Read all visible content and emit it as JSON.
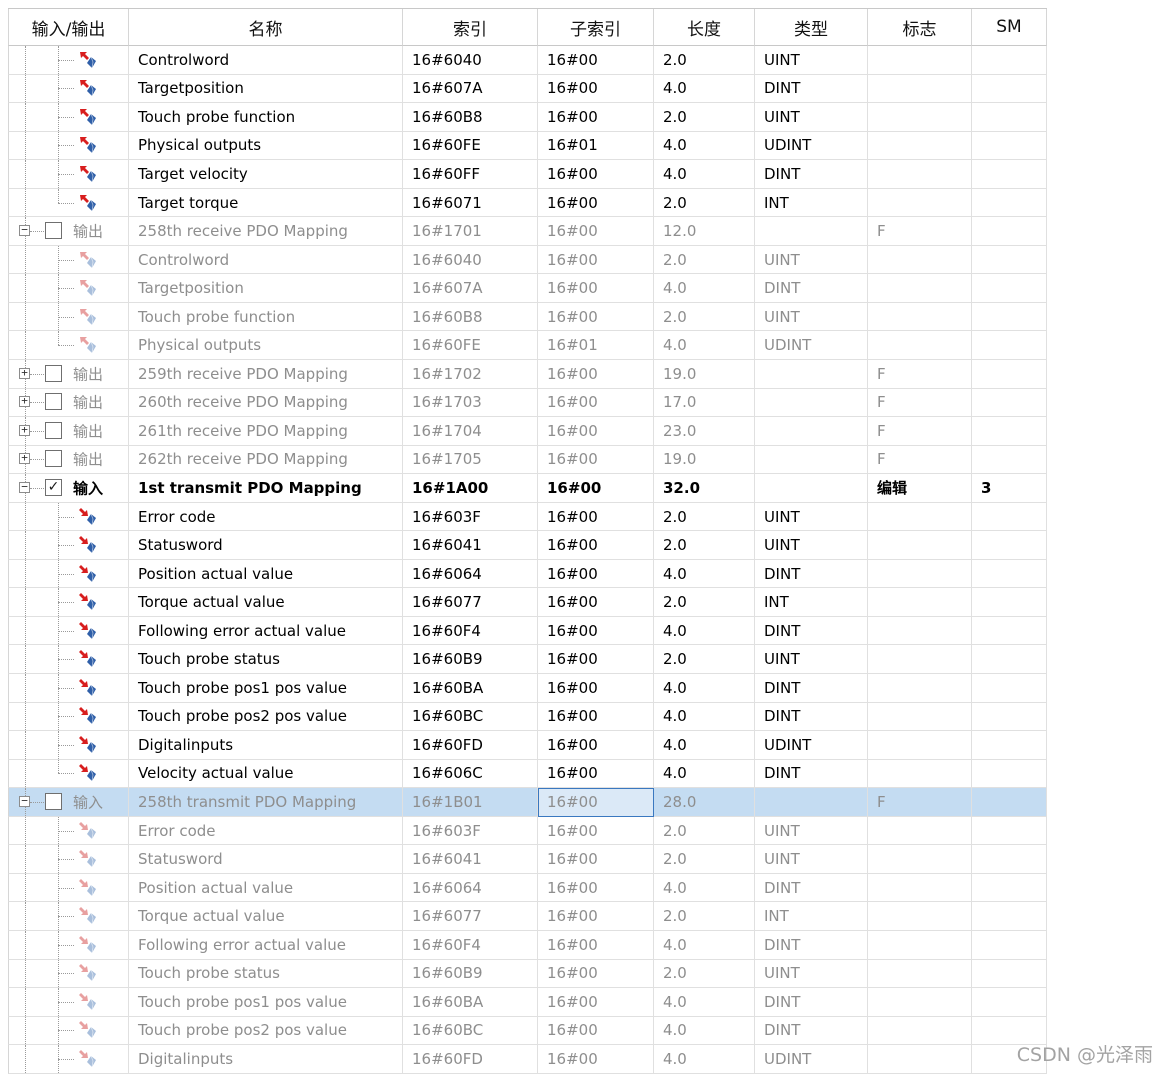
{
  "columns": [
    "输入/输出",
    "名称",
    "索引",
    "子索引",
    "长度",
    "类型",
    "标志",
    "SM"
  ],
  "icons": {
    "expand": "tree-expand-icon",
    "collapse": "tree-collapse-icon",
    "checkbox": "checkbox-icon",
    "param": "pdo-entry-icon"
  },
  "colors": {
    "selection": "#c4dcf2",
    "disabled_text": "#8e8e8e",
    "arrow_red": "#d81e1e",
    "gem_blue": "#2f5fa8"
  },
  "rows": [
    {
      "kind": "child",
      "state": "en",
      "name": "Controlword",
      "index": "16#6040",
      "sub": "16#00",
      "len": "2.0",
      "type": "UINT",
      "flag": "",
      "sm": "",
      "dir": "out"
    },
    {
      "kind": "child",
      "state": "en",
      "name": "Targetposition",
      "index": "16#607A",
      "sub": "16#00",
      "len": "4.0",
      "type": "DINT",
      "flag": "",
      "sm": "",
      "dir": "out"
    },
    {
      "kind": "child",
      "state": "en",
      "name": "Touch probe function",
      "index": "16#60B8",
      "sub": "16#00",
      "len": "2.0",
      "type": "UINT",
      "flag": "",
      "sm": "",
      "dir": "out"
    },
    {
      "kind": "child",
      "state": "en",
      "name": "Physical outputs",
      "index": "16#60FE",
      "sub": "16#01",
      "len": "4.0",
      "type": "UDINT",
      "flag": "",
      "sm": "",
      "dir": "out"
    },
    {
      "kind": "child",
      "state": "en",
      "name": "Target velocity",
      "index": "16#60FF",
      "sub": "16#00",
      "len": "4.0",
      "type": "DINT",
      "flag": "",
      "sm": "",
      "dir": "out"
    },
    {
      "kind": "child",
      "state": "en",
      "name": "Target torque",
      "index": "16#6071",
      "sub": "16#00",
      "len": "2.0",
      "type": "INT",
      "flag": "",
      "sm": "",
      "dir": "out",
      "last": true
    },
    {
      "kind": "group",
      "state": "dis",
      "expander": "−",
      "checked": false,
      "io": "输出",
      "name": "258th receive PDO Mapping",
      "index": "16#1701",
      "sub": "16#00",
      "len": "12.0",
      "type": "",
      "flag": "F",
      "sm": ""
    },
    {
      "kind": "child",
      "state": "dis",
      "name": "Controlword",
      "index": "16#6040",
      "sub": "16#00",
      "len": "2.0",
      "type": "UINT",
      "flag": "",
      "sm": "",
      "dir": "out"
    },
    {
      "kind": "child",
      "state": "dis",
      "name": "Targetposition",
      "index": "16#607A",
      "sub": "16#00",
      "len": "4.0",
      "type": "DINT",
      "flag": "",
      "sm": "",
      "dir": "out"
    },
    {
      "kind": "child",
      "state": "dis",
      "name": "Touch probe function",
      "index": "16#60B8",
      "sub": "16#00",
      "len": "2.0",
      "type": "UINT",
      "flag": "",
      "sm": "",
      "dir": "out"
    },
    {
      "kind": "child",
      "state": "dis",
      "name": "Physical outputs",
      "index": "16#60FE",
      "sub": "16#01",
      "len": "4.0",
      "type": "UDINT",
      "flag": "",
      "sm": "",
      "dir": "out",
      "last": true
    },
    {
      "kind": "group",
      "state": "dis",
      "expander": "+",
      "checked": false,
      "io": "输出",
      "name": "259th receive PDO Mapping",
      "index": "16#1702",
      "sub": "16#00",
      "len": "19.0",
      "type": "",
      "flag": "F",
      "sm": ""
    },
    {
      "kind": "group",
      "state": "dis",
      "expander": "+",
      "checked": false,
      "io": "输出",
      "name": "260th receive PDO Mapping",
      "index": "16#1703",
      "sub": "16#00",
      "len": "17.0",
      "type": "",
      "flag": "F",
      "sm": ""
    },
    {
      "kind": "group",
      "state": "dis",
      "expander": "+",
      "checked": false,
      "io": "输出",
      "name": "261th receive PDO Mapping",
      "index": "16#1704",
      "sub": "16#00",
      "len": "23.0",
      "type": "",
      "flag": "F",
      "sm": ""
    },
    {
      "kind": "group",
      "state": "dis",
      "expander": "+",
      "checked": false,
      "io": "输出",
      "name": "262th receive PDO Mapping",
      "index": "16#1705",
      "sub": "16#00",
      "len": "19.0",
      "type": "",
      "flag": "F",
      "sm": ""
    },
    {
      "kind": "group",
      "state": "bold",
      "expander": "−",
      "checked": true,
      "io": "输入",
      "name": "1st transmit PDO Mapping",
      "index": "16#1A00",
      "sub": "16#00",
      "len": "32.0",
      "type": "",
      "flag": "编辑",
      "sm": "3"
    },
    {
      "kind": "child",
      "state": "en",
      "name": "Error code",
      "index": "16#603F",
      "sub": "16#00",
      "len": "2.0",
      "type": "UINT",
      "flag": "",
      "sm": "",
      "dir": "in"
    },
    {
      "kind": "child",
      "state": "en",
      "name": "Statusword",
      "index": "16#6041",
      "sub": "16#00",
      "len": "2.0",
      "type": "UINT",
      "flag": "",
      "sm": "",
      "dir": "in"
    },
    {
      "kind": "child",
      "state": "en",
      "name": "Position actual value",
      "index": "16#6064",
      "sub": "16#00",
      "len": "4.0",
      "type": "DINT",
      "flag": "",
      "sm": "",
      "dir": "in"
    },
    {
      "kind": "child",
      "state": "en",
      "name": "Torque actual value",
      "index": "16#6077",
      "sub": "16#00",
      "len": "2.0",
      "type": "INT",
      "flag": "",
      "sm": "",
      "dir": "in"
    },
    {
      "kind": "child",
      "state": "en",
      "name": "Following error actual value",
      "index": "16#60F4",
      "sub": "16#00",
      "len": "4.0",
      "type": "DINT",
      "flag": "",
      "sm": "",
      "dir": "in"
    },
    {
      "kind": "child",
      "state": "en",
      "name": "Touch probe status",
      "index": "16#60B9",
      "sub": "16#00",
      "len": "2.0",
      "type": "UINT",
      "flag": "",
      "sm": "",
      "dir": "in"
    },
    {
      "kind": "child",
      "state": "en",
      "name": "Touch probe pos1 pos value",
      "index": "16#60BA",
      "sub": "16#00",
      "len": "4.0",
      "type": "DINT",
      "flag": "",
      "sm": "",
      "dir": "in"
    },
    {
      "kind": "child",
      "state": "en",
      "name": "Touch probe pos2 pos value",
      "index": "16#60BC",
      "sub": "16#00",
      "len": "4.0",
      "type": "DINT",
      "flag": "",
      "sm": "",
      "dir": "in"
    },
    {
      "kind": "child",
      "state": "en",
      "name": "Digitalinputs",
      "index": "16#60FD",
      "sub": "16#00",
      "len": "4.0",
      "type": "UDINT",
      "flag": "",
      "sm": "",
      "dir": "in"
    },
    {
      "kind": "child",
      "state": "en",
      "name": "Velocity actual value",
      "index": "16#606C",
      "sub": "16#00",
      "len": "4.0",
      "type": "DINT",
      "flag": "",
      "sm": "",
      "dir": "in",
      "last": true
    },
    {
      "kind": "group",
      "state": "dis",
      "sel": true,
      "expander": "−",
      "checked": false,
      "io": "输入",
      "name": "258th transmit PDO Mapping",
      "index": "16#1B01",
      "sub": "16#00",
      "len": "28.0",
      "type": "",
      "flag": "F",
      "sm": ""
    },
    {
      "kind": "child",
      "state": "dis",
      "name": "Error code",
      "index": "16#603F",
      "sub": "16#00",
      "len": "2.0",
      "type": "UINT",
      "flag": "",
      "sm": "",
      "dir": "in"
    },
    {
      "kind": "child",
      "state": "dis",
      "name": "Statusword",
      "index": "16#6041",
      "sub": "16#00",
      "len": "2.0",
      "type": "UINT",
      "flag": "",
      "sm": "",
      "dir": "in"
    },
    {
      "kind": "child",
      "state": "dis",
      "name": "Position actual value",
      "index": "16#6064",
      "sub": "16#00",
      "len": "4.0",
      "type": "DINT",
      "flag": "",
      "sm": "",
      "dir": "in"
    },
    {
      "kind": "child",
      "state": "dis",
      "name": "Torque actual value",
      "index": "16#6077",
      "sub": "16#00",
      "len": "2.0",
      "type": "INT",
      "flag": "",
      "sm": "",
      "dir": "in"
    },
    {
      "kind": "child",
      "state": "dis",
      "name": "Following error actual value",
      "index": "16#60F4",
      "sub": "16#00",
      "len": "4.0",
      "type": "DINT",
      "flag": "",
      "sm": "",
      "dir": "in"
    },
    {
      "kind": "child",
      "state": "dis",
      "name": "Touch probe status",
      "index": "16#60B9",
      "sub": "16#00",
      "len": "2.0",
      "type": "UINT",
      "flag": "",
      "sm": "",
      "dir": "in"
    },
    {
      "kind": "child",
      "state": "dis",
      "name": "Touch probe pos1 pos value",
      "index": "16#60BA",
      "sub": "16#00",
      "len": "4.0",
      "type": "DINT",
      "flag": "",
      "sm": "",
      "dir": "in"
    },
    {
      "kind": "child",
      "state": "dis",
      "name": "Touch probe pos2 pos value",
      "index": "16#60BC",
      "sub": "16#00",
      "len": "4.0",
      "type": "DINT",
      "flag": "",
      "sm": "",
      "dir": "in"
    },
    {
      "kind": "child",
      "state": "dis",
      "name": "Digitalinputs",
      "index": "16#60FD",
      "sub": "16#00",
      "len": "4.0",
      "type": "UDINT",
      "flag": "",
      "sm": "",
      "dir": "in"
    }
  ],
  "watermark": "CSDN @光泽雨"
}
